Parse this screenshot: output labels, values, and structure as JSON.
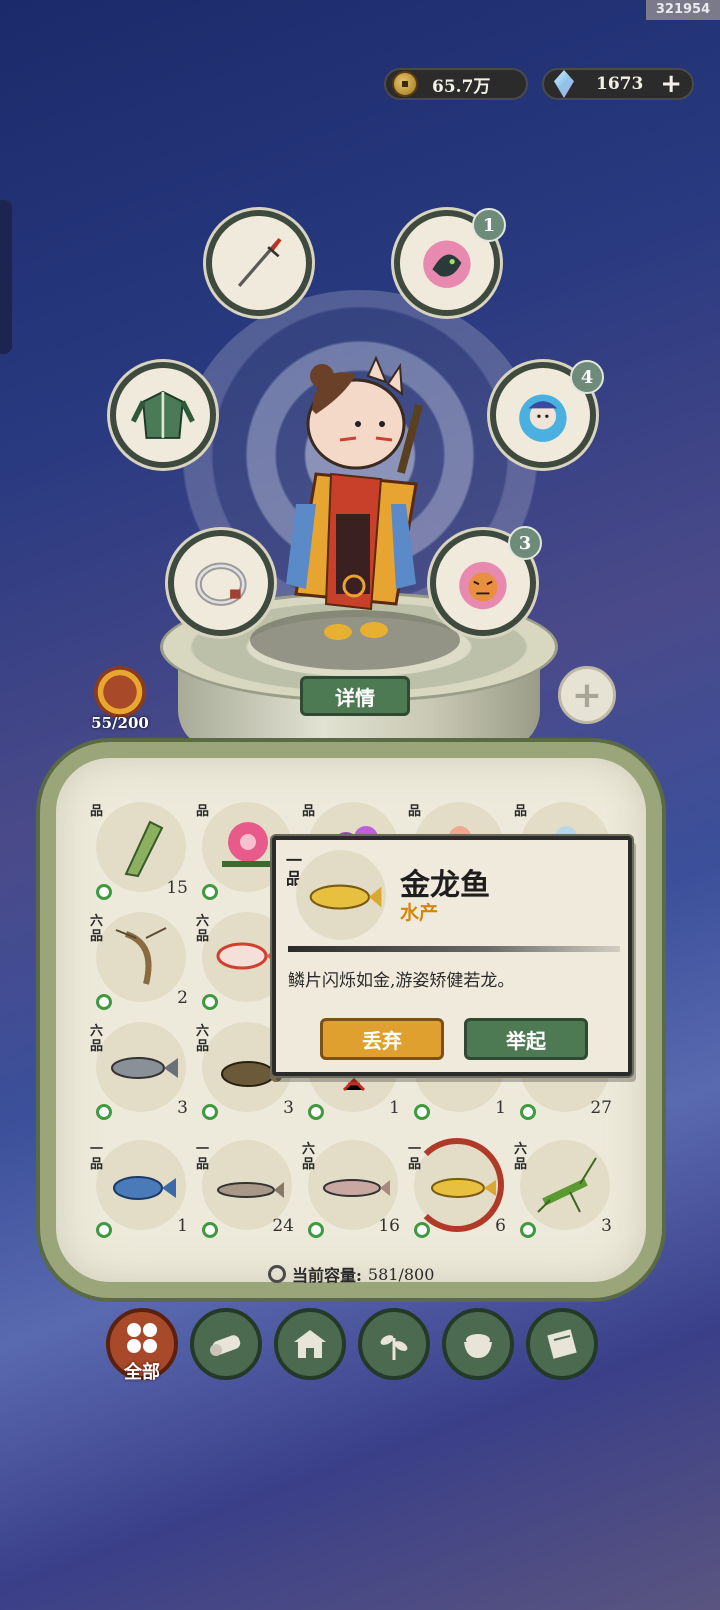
{
  "screen_id": "321954",
  "currency": {
    "coins": "65.7万",
    "gems": "1673",
    "coin_icon": "copper-coin-icon",
    "gem_icon": "spirit-gem-icon"
  },
  "equipment": {
    "slots": [
      {
        "name": "weapon-slot",
        "icon": "sword-icon",
        "badge": null
      },
      {
        "name": "pet-slot-1",
        "icon": "dragon-spirit-icon",
        "badge": "1"
      },
      {
        "name": "armor-slot",
        "icon": "leaf-robe-icon",
        "badge": null
      },
      {
        "name": "pet-slot-2",
        "icon": "blue-spirit-icon",
        "badge": "4"
      },
      {
        "name": "ring-slot",
        "icon": "bracelet-icon",
        "badge": null
      },
      {
        "name": "pet-slot-3",
        "icon": "tiger-spirit-icon",
        "badge": "3"
      }
    ]
  },
  "details_button": "详情",
  "companion": {
    "level": "55/200"
  },
  "inventory": {
    "rows": [
      [
        {
          "grade": "品",
          "count": "15",
          "icon": "bamboo-shoot-icon"
        },
        {
          "grade": "品",
          "count": "",
          "icon": "azalea-flower-icon"
        },
        {
          "grade": "品",
          "count": "",
          "icon": "morning-glory-icon"
        },
        {
          "grade": "品",
          "count": "",
          "icon": "pink-egg-icon"
        },
        {
          "grade": "品",
          "count": "",
          "icon": "blue-egg-icon"
        }
      ],
      [
        {
          "grade": "六品",
          "count": "2",
          "icon": "shrimp-icon"
        },
        {
          "grade": "六品",
          "count": "",
          "icon": "red-fish-icon"
        },
        {
          "grade": "",
          "count": "",
          "icon": ""
        },
        {
          "grade": "",
          "count": "",
          "icon": ""
        },
        {
          "grade": "",
          "count": "",
          "icon": ""
        }
      ],
      [
        {
          "grade": "六品",
          "count": "3",
          "icon": "carp-icon"
        },
        {
          "grade": "六品",
          "count": "3",
          "icon": "turtle-icon"
        },
        {
          "grade": "",
          "count": "1",
          "icon": "crayfish-icon"
        },
        {
          "grade": "",
          "count": "1",
          "icon": ""
        },
        {
          "grade": "",
          "count": "27",
          "icon": ""
        }
      ],
      [
        {
          "grade": "一品",
          "count": "1",
          "icon": "blue-fish-icon"
        },
        {
          "grade": "一品",
          "count": "24",
          "icon": "catfish-icon"
        },
        {
          "grade": "六品",
          "count": "16",
          "icon": "trout-icon"
        },
        {
          "grade": "一品",
          "count": "6",
          "icon": "golden-arowana-icon",
          "selected": true
        },
        {
          "grade": "六品",
          "count": "3",
          "icon": "grasshopper-icon"
        }
      ]
    ],
    "capacity_label": "当前容量:",
    "capacity_value": "581/800"
  },
  "item_popup": {
    "grade": "一品",
    "name": "金龙鱼",
    "category": "水产",
    "description": "鳞片闪烁如金,游姿矫健若龙。",
    "discard_button": "丢弃",
    "lift_button": "举起"
  },
  "tabs": [
    {
      "label": "全部",
      "icon": "all-items-icon",
      "active": true
    },
    {
      "label": "",
      "icon": "wood-log-icon"
    },
    {
      "label": "",
      "icon": "house-icon"
    },
    {
      "label": "",
      "icon": "herb-sprout-icon"
    },
    {
      "label": "",
      "icon": "rice-bowl-icon"
    },
    {
      "label": "",
      "icon": "scroll-icon"
    }
  ],
  "colors": {
    "accent_green": "#4d7a52",
    "accent_orange": "#e0a030",
    "category_orange": "#d4860a",
    "selection_red": "#b03a28"
  }
}
